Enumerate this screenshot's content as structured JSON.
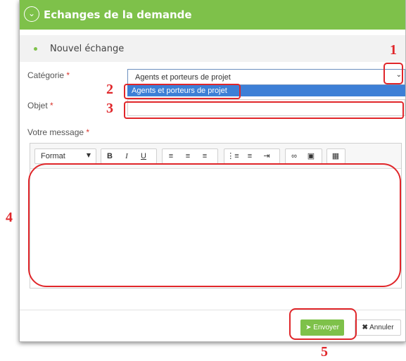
{
  "panel": {
    "title": "Echanges de la demande",
    "toggle_icon": "chevron-down-icon",
    "header_color": "#7ec14a"
  },
  "section": {
    "title": "Nouvel échange"
  },
  "form": {
    "categorie_label": "Catégorie",
    "required_mark": "*",
    "categorie_value": "Agents et porteurs de projet",
    "categorie_option": "Agents et porteurs de projet",
    "objet_label": "Objet",
    "objet_value": "",
    "message_label": "Votre message"
  },
  "toolbar": {
    "format_label": "Format",
    "bold": "B",
    "italic": "I",
    "underline": "U"
  },
  "buttons": {
    "send_label": "Envoyer",
    "cancel_label": "Annuler"
  },
  "callouts": {
    "n1": "1",
    "n2": "2",
    "n3": "3",
    "n4": "4",
    "n5": "5",
    "color": "#e0262a"
  }
}
